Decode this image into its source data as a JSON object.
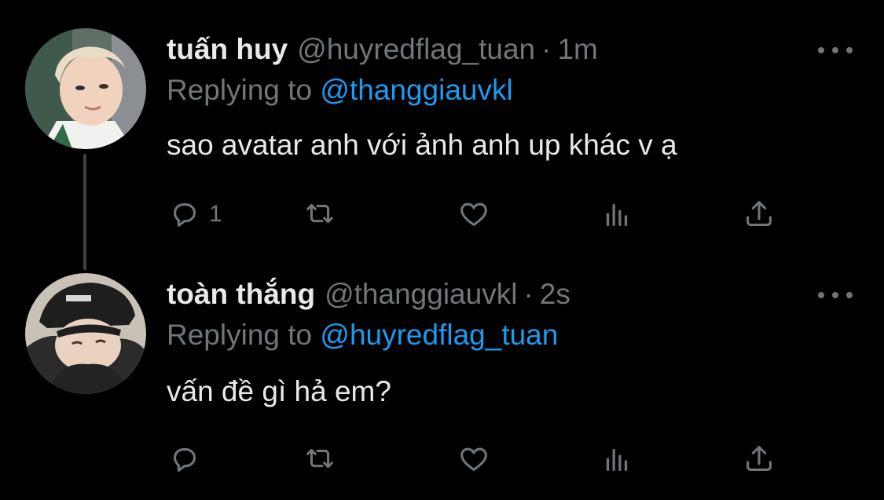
{
  "tweets": [
    {
      "display_name": "tuấn huy",
      "handle": "@huyredflag_tuan",
      "separator": "·",
      "time": "1m",
      "replying_prefix": "Replying to",
      "replying_to": "@thanggiauvkl",
      "text": "sao avatar anh với ảnh anh up khác v ạ",
      "reply_count": "1"
    },
    {
      "display_name": "toàn thắng",
      "handle": "@thanggiauvkl",
      "separator": "·",
      "time": "2s",
      "replying_prefix": "Replying to",
      "replying_to": "@huyredflag_tuan",
      "text": "vấn đề gì hả em?",
      "reply_count": ""
    }
  ],
  "icons": [
    "reply-icon",
    "retweet-icon",
    "like-icon",
    "analytics-icon",
    "share-icon",
    "more-icon"
  ],
  "colors": {
    "background": "#000000",
    "text": "#e7e9ea",
    "muted": "#71767b",
    "accent": "#1d9bf0"
  }
}
